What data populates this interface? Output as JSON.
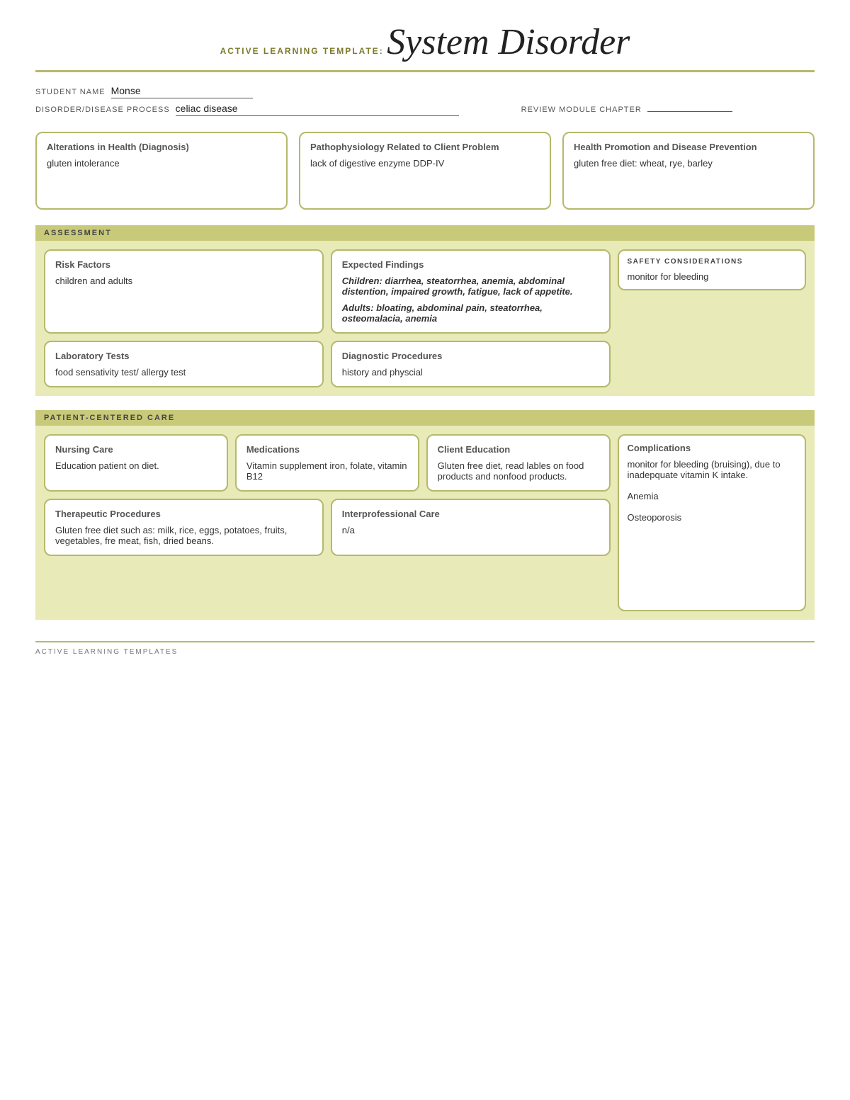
{
  "header": {
    "active_label": "Active Learning Template:",
    "title": "System Disorder",
    "footer_label": "ACTIVE LEARNING TEMPLATES"
  },
  "form": {
    "student_name_label": "STUDENT NAME",
    "student_name_value": "Monse",
    "disorder_label": "DISORDER/DISEASE PROCESS",
    "disorder_value": "celiac disease",
    "review_label": "REVIEW MODULE CHAPTER"
  },
  "top_cards": [
    {
      "title": "Alterations in Health (Diagnosis)",
      "content": "gluten intolerance"
    },
    {
      "title": "Pathophysiology Related to Client Problem",
      "content": "lack of digestive enzyme DDP-IV"
    },
    {
      "title": "Health Promotion and Disease Prevention",
      "content": "gluten free diet: wheat, rye, barley"
    }
  ],
  "assessment": {
    "section_label": "ASSESSMENT",
    "safety_label": "SAFETY CONSIDERATIONS",
    "safety_content": "monitor for bleeding",
    "cards": [
      {
        "title": "Risk Factors",
        "content": "children and adults"
      },
      {
        "title": "Expected Findings",
        "content_bold": "Children: diarrhea, steatorrhea, anemia, abdominal distention, impaired growth, fatigue, lack of appetite.",
        "content_bold2": "Adults: bloating, abdominal pain, steatorrhea, osteomalacia, anemia"
      },
      {
        "title": "Laboratory Tests",
        "content": "food sensativity test/ allergy test"
      },
      {
        "title": "Diagnostic Procedures",
        "content": "history and physcial"
      }
    ]
  },
  "patient_care": {
    "section_label": "PATIENT-CENTERED CARE",
    "complications_title": "Complications",
    "complications_content": "monitor for bleeding (bruising), due to inadepquate vitamin K intake.\n\nAnemia\n\nOsteoporosis",
    "top_cards": [
      {
        "title": "Nursing Care",
        "content": "Education patient on diet."
      },
      {
        "title": "Medications",
        "content": "Vitamin supplement iron, folate, vitamin B12"
      },
      {
        "title": "Client Education",
        "content": "Gluten free diet,  read lables on food products and nonfood products."
      }
    ],
    "bottom_cards": [
      {
        "title": "Therapeutic Procedures",
        "content": "Gluten free diet such as: milk, rice, eggs, potatoes, fruits, vegetables, fre meat, fish, dried beans."
      },
      {
        "title": "Interprofessional Care",
        "content": "n/a"
      }
    ]
  }
}
